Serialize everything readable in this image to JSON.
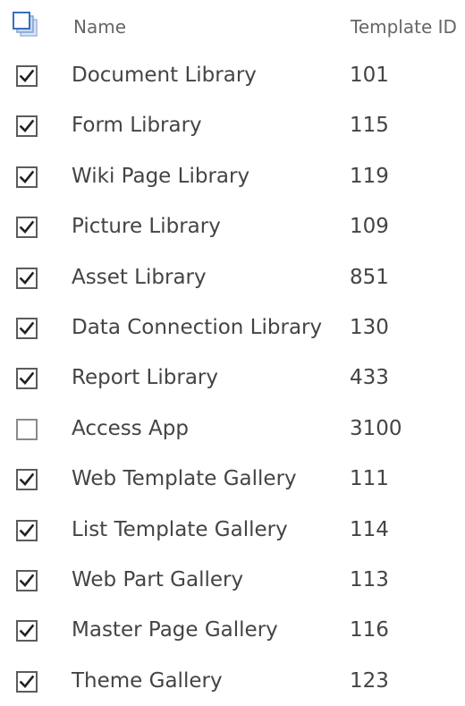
{
  "columns": {
    "name": "Name",
    "template_id": "Template ID"
  },
  "rows": [
    {
      "name": "Document Library",
      "template_id": "101",
      "checked": true
    },
    {
      "name": "Form Library",
      "template_id": "115",
      "checked": true
    },
    {
      "name": "Wiki Page Library",
      "template_id": "119",
      "checked": true
    },
    {
      "name": "Picture Library",
      "template_id": "109",
      "checked": true
    },
    {
      "name": "Asset Library",
      "template_id": "851",
      "checked": true
    },
    {
      "name": "Data Connection Library",
      "template_id": "130",
      "checked": true
    },
    {
      "name": "Report Library",
      "template_id": "433",
      "checked": true
    },
    {
      "name": "Access App",
      "template_id": "3100",
      "checked": false
    },
    {
      "name": "Web Template Gallery",
      "template_id": "111",
      "checked": true
    },
    {
      "name": "List Template Gallery",
      "template_id": "114",
      "checked": true
    },
    {
      "name": "Web Part Gallery",
      "template_id": "113",
      "checked": true
    },
    {
      "name": "Master Page Gallery",
      "template_id": "116",
      "checked": true
    },
    {
      "name": "Theme Gallery",
      "template_id": "123",
      "checked": true
    }
  ],
  "colors": {
    "checkbox_border": "#5c5c5c",
    "checkmark": "#222222",
    "select_all_icon": "#3a6fc4"
  },
  "icons": {
    "select_all": "select-all-icon",
    "checkbox": "checkbox-icon",
    "checkmark": "checkmark-icon"
  }
}
